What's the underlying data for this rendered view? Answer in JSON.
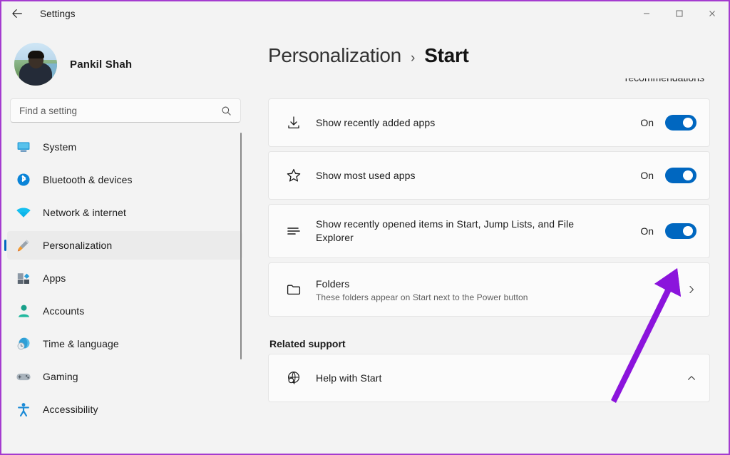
{
  "window": {
    "app_title": "Settings",
    "back_icon": "back-arrow-icon",
    "minimize_label": "—",
    "maximize_label": "□",
    "close_label": "✕"
  },
  "sidebar": {
    "account": {
      "name": "Pankil Shah",
      "avatar_icon": "user-avatar-photo"
    },
    "search": {
      "placeholder": "Find a setting",
      "value": "",
      "icon": "search-icon"
    },
    "items": [
      {
        "label": "System",
        "icon": "monitor-icon",
        "active": false
      },
      {
        "label": "Bluetooth & devices",
        "icon": "bluetooth-icon",
        "active": false
      },
      {
        "label": "Network & internet",
        "icon": "wifi-icon",
        "active": false
      },
      {
        "label": "Personalization",
        "icon": "paintbrush-icon",
        "active": true
      },
      {
        "label": "Apps",
        "icon": "apps-grid-icon",
        "active": false
      },
      {
        "label": "Accounts",
        "icon": "person-icon",
        "active": false
      },
      {
        "label": "Time & language",
        "icon": "clock-globe-icon",
        "active": false
      },
      {
        "label": "Gaming",
        "icon": "gamepad-icon",
        "active": false
      },
      {
        "label": "Accessibility",
        "icon": "accessibility-icon",
        "active": false
      }
    ]
  },
  "main": {
    "breadcrumb": {
      "parent": "Personalization",
      "separator": "›",
      "current": "Start"
    },
    "clipped_top_text": "recommendations",
    "settings": [
      {
        "title": "Show recently added apps",
        "subtitle": "",
        "icon": "download-icon",
        "control": "toggle",
        "state": "On"
      },
      {
        "title": "Show most used apps",
        "subtitle": "",
        "icon": "star-icon",
        "control": "toggle",
        "state": "On"
      },
      {
        "title": "Show recently opened items in Start, Jump Lists, and File Explorer",
        "subtitle": "",
        "icon": "recent-items-icon",
        "control": "toggle",
        "state": "On"
      },
      {
        "title": "Folders",
        "subtitle": "These folders appear on Start next to the Power button",
        "icon": "folder-icon",
        "control": "chevron",
        "state": ""
      }
    ],
    "related_support": {
      "heading": "Related support",
      "item": {
        "title": "Help with Start",
        "icon": "globe-search-icon",
        "control": "chevron-up"
      }
    }
  },
  "annotation": {
    "arrow_color": "#8b14dc",
    "frame_color": "#a43bcf"
  },
  "colors": {
    "accent": "#0067c0",
    "background": "#f3f3f3",
    "card": "#fbfbfb",
    "text": "#1b1b1b"
  }
}
